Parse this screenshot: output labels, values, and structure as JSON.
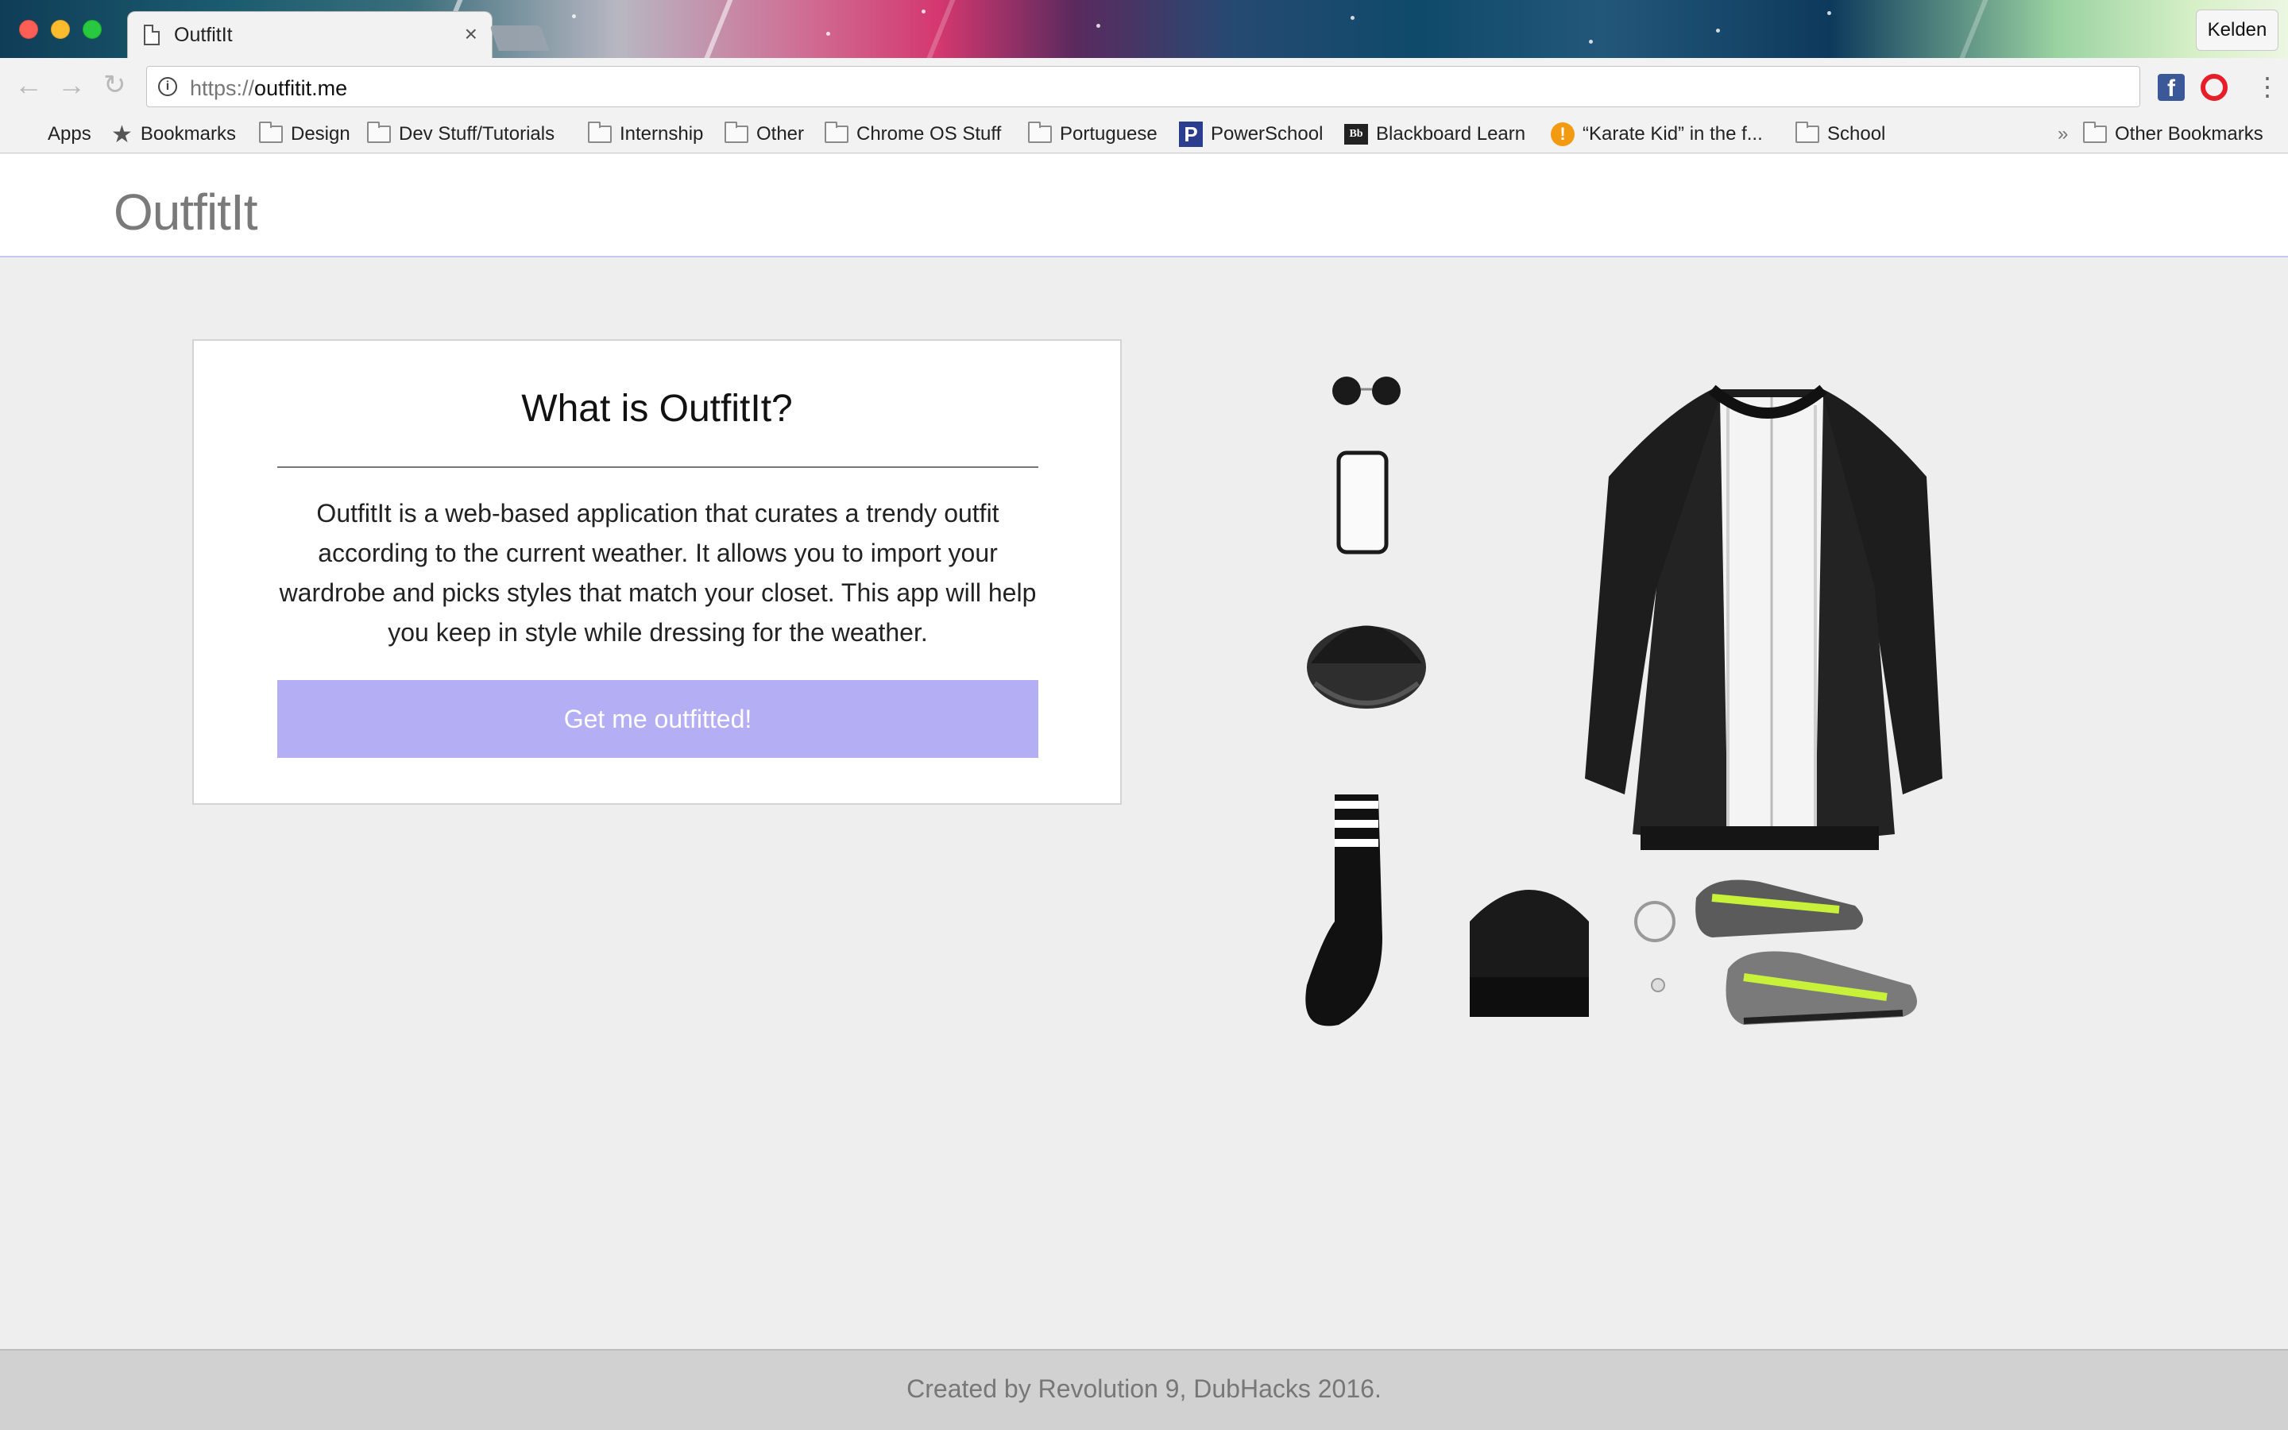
{
  "browser": {
    "tab_title": "OutfitIt",
    "tab_close": "×",
    "profile_name": "Kelden",
    "url_scheme": "https://",
    "url_host": "outfitit.me",
    "nav": {
      "back": "←",
      "forward": "→",
      "reload": "↻"
    },
    "extensions": {
      "facebook": "f"
    },
    "menu_glyph": "⋮",
    "bookmarks": [
      {
        "label": "Apps",
        "icon": "apps-grid-icon"
      },
      {
        "label": "Bookmarks",
        "icon": "star-icon"
      },
      {
        "label": "Design",
        "icon": "folder-icon"
      },
      {
        "label": "Dev Stuff/Tutorials",
        "icon": "folder-icon"
      },
      {
        "label": "Internship",
        "icon": "folder-icon"
      },
      {
        "label": "Other",
        "icon": "folder-icon"
      },
      {
        "label": "Chrome OS Stuff",
        "icon": "folder-icon"
      },
      {
        "label": "Portuguese",
        "icon": "folder-icon"
      },
      {
        "label": "PowerSchool",
        "icon": "powerschool-icon",
        "glyph": "P"
      },
      {
        "label": "Blackboard Learn",
        "icon": "blackboard-icon",
        "glyph": "Bb"
      },
      {
        "label": "“Karate Kid” in the f...",
        "icon": "karate-icon",
        "glyph": "!"
      },
      {
        "label": "School",
        "icon": "folder-icon"
      },
      {
        "label": "Other Bookmarks",
        "icon": "folder-icon"
      }
    ],
    "bookmarks_overflow": "»"
  },
  "site": {
    "logo": "OutfitIt",
    "card": {
      "title": "What is OutfitIt?",
      "body": "OutfitIt is a web-based application that curates a trendy outfit according to the current weather. It allows you to import your wardrobe and picks styles that match your closet. This app will help you keep in style while dressing for the weather.",
      "button_label": "Get me outfitted!"
    },
    "footer": "Created by Revolution 9, DubHacks 2016.",
    "colors": {
      "accent": "#b4aef5",
      "header_border": "#c9c6ef",
      "footer_bg": "#d1d1d1"
    }
  }
}
